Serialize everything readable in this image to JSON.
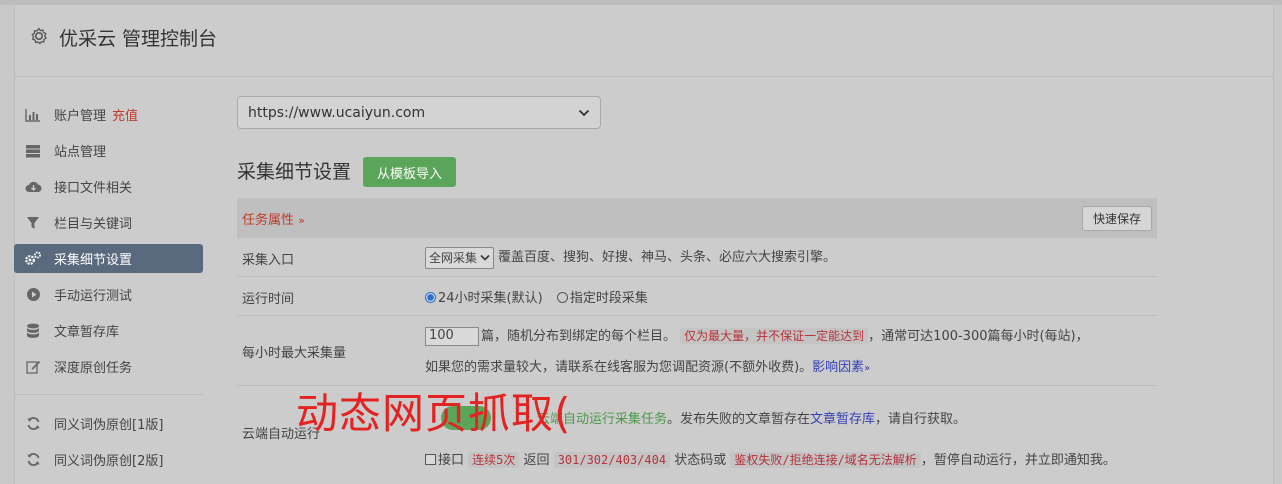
{
  "header": {
    "title": "优采云 管理控制台"
  },
  "sidebar": {
    "items": [
      {
        "label": "账户管理",
        "extra": "充值",
        "icon": "bar-chart-icon"
      },
      {
        "label": "站点管理",
        "icon": "server-icon"
      },
      {
        "label": "接口文件相关",
        "icon": "cloud-download-icon"
      },
      {
        "label": "栏目与关键词",
        "icon": "filter-icon"
      },
      {
        "label": "采集细节设置",
        "icon": "cogs-icon",
        "active": true
      },
      {
        "label": "手动运行测试",
        "icon": "play-circle-icon"
      },
      {
        "label": "文章暂存库",
        "icon": "database-icon"
      },
      {
        "label": "深度原创任务",
        "icon": "edit-icon"
      },
      {
        "label": "同义词伪原创[1版]",
        "icon": "refresh-icon"
      },
      {
        "label": "同义词伪原创[2版]",
        "icon": "refresh-icon"
      }
    ]
  },
  "main": {
    "site_select_value": "https://www.ucaiyun.com",
    "section_title": "采集细节设置",
    "import_button": "从模板导入",
    "tasks_label": "任务属性",
    "save_button": "快速保存",
    "rows": {
      "entry": {
        "label": "采集入口",
        "select_value": "全网采集",
        "desc": "覆盖百度、搜狗、好搜、神马、头条、必应六大搜索引擎。"
      },
      "runtime": {
        "label": "运行时间",
        "option1": "24小时采集(默认)",
        "option2": "指定时段采集"
      },
      "max_per_hour": {
        "label": "每小时最大采集量",
        "value": "100",
        "text1": "篇，随机分布到绑定的每个栏目。",
        "code": "仅为最大量，并不保证一定能达到",
        "text2": "，通常可达100-300篇每小时(每站)，",
        "text3": "如果您的需求量较大，请联系在线客服为您调配资源(不额外收费)。",
        "link": "影响因素"
      },
      "cloud_auto": {
        "label": "云端自动运行",
        "green": "云端自动运行采集任务",
        "text1": "。发布失败的文章暂存在",
        "link": "文章暂存库",
        "text2": "，请自行获取。",
        "interface": "接口",
        "code1": "连续5次",
        "returns": "返回",
        "code2": "301/302/403/404",
        "status_or": "状态码或",
        "code3": "鉴权失败/拒绝连接/域名无法解析",
        "tail": "，暂停自动运行，并立即通知我。"
      }
    }
  },
  "overlay": {
    "watermark": "动态网页抓取("
  },
  "colors": {
    "active_nav": "#5a6a7e",
    "green": "#5aa55a",
    "red": "#c0392b",
    "link": "#3340b5"
  }
}
